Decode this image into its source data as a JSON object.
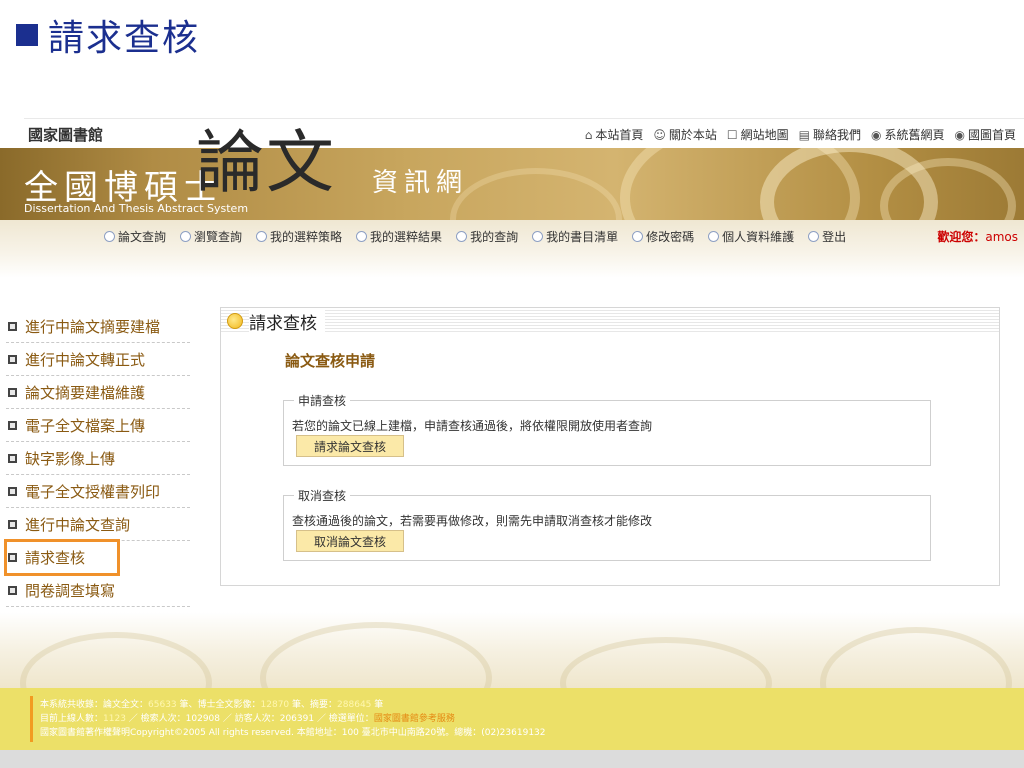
{
  "slide": {
    "title": "請求查核"
  },
  "header": {
    "library": "國家圖書館",
    "toplinks": [
      {
        "icon": "home-icon",
        "glyph": "⌂",
        "label": "本站首頁"
      },
      {
        "icon": "smile-icon",
        "glyph": "☺",
        "label": "關於本站"
      },
      {
        "icon": "sitemap-icon",
        "glyph": "☐",
        "label": "網站地圖"
      },
      {
        "icon": "contact-icon",
        "glyph": "▤",
        "label": "聯絡我們"
      },
      {
        "icon": "globe-icon",
        "glyph": "◉",
        "label": "系統舊網頁"
      },
      {
        "icon": "globe-icon",
        "glyph": "◉",
        "label": "國圖首頁"
      }
    ],
    "brand_main": "全國博碩士",
    "brand_big": "論文",
    "brand_end": "資訊網",
    "brand_sub": "Dissertation And Thesis Abstract  System"
  },
  "nav": {
    "items": [
      "論文查詢",
      "瀏覽查詢",
      "我的選粹策略",
      "我的選粹結果",
      "我的查詢",
      "我的書目清單",
      "修改密碼",
      "個人資料維護",
      "登出"
    ],
    "welcome": "歡迎您：",
    "username": "amos"
  },
  "sidebar": {
    "items": [
      "進行中論文摘要建檔",
      "進行中論文轉正式",
      "論文摘要建檔維護",
      "電子全文檔案上傳",
      "缺字影像上傳",
      "電子全文授權書列印",
      "進行中論文查詢",
      "請求查核",
      "問卷調查填寫"
    ],
    "active_index": 7
  },
  "panel": {
    "header": "請求查核",
    "section_title": "論文查核申請",
    "request": {
      "legend": "申請查核",
      "desc": "若您的論文已線上建檔，申請查核通過後，將依權限開放使用者查詢",
      "button": "請求論文查核"
    },
    "cancel": {
      "legend": "取消查核",
      "desc": "查核通過後的論文，若需要再做修改，則需先申請取消查核才能修改",
      "button": "取消論文查核"
    }
  },
  "footer": {
    "line1_prefix": "本系統共收錄：論文全文：",
    "line1_v1": "65633",
    "line1_mid1": " 筆、博士全文影像：",
    "line1_v2": "12870",
    "line1_mid2": " 筆、摘要：",
    "line1_v3": "288645",
    "line1_suffix": " 筆",
    "line2_prefix": "目前上線人數：",
    "line2_online": "1123",
    "line2_mid1": " ／ 檢索人次：102908 ／ 訪客人次：206391 ／ 檢選單位：",
    "line2_link": "國家圖書館參考服務",
    "line3": "國家圖書館著作權聲明Copyright©2005 All rights reserved. 本館地址：100 臺北市中山南路20號。總機：(02)23619132"
  }
}
